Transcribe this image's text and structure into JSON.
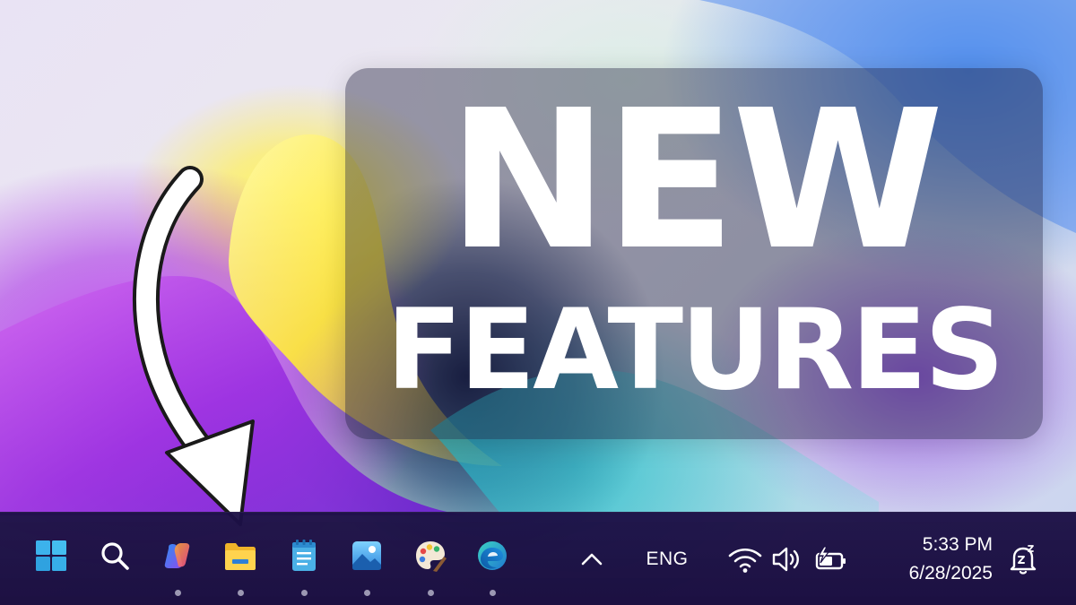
{
  "headline": {
    "line1": "NEW",
    "line2": "FEATURES"
  },
  "taskbar": {
    "apps": [
      {
        "name": "start",
        "icon": "windows-logo-icon",
        "running": false
      },
      {
        "name": "search",
        "icon": "search-icon",
        "running": false
      },
      {
        "name": "copilot",
        "icon": "copilot-icon",
        "running": true
      },
      {
        "name": "file-explorer",
        "icon": "folder-icon",
        "running": true
      },
      {
        "name": "notepad",
        "icon": "notepad-icon",
        "running": true
      },
      {
        "name": "photos",
        "icon": "photos-icon",
        "running": true
      },
      {
        "name": "paint",
        "icon": "paint-palette-icon",
        "running": true
      },
      {
        "name": "edge",
        "icon": "edge-browser-icon",
        "running": true
      }
    ],
    "tray": {
      "overflow_icon": "chevron-up-icon",
      "language": "ENG",
      "wifi_icon": "wifi-icon",
      "volume_icon": "speaker-icon",
      "battery_icon": "battery-charging-icon",
      "notification_icon": "notification-bell-snooze-icon"
    },
    "clock": {
      "time": "5:33 PM",
      "date": "6/28/2025"
    }
  },
  "colors": {
    "taskbar_bg": "#1c1046",
    "accent_blue": "#3aa8e8",
    "folder_yellow": "#f7c948",
    "headline_text": "#ffffff"
  }
}
